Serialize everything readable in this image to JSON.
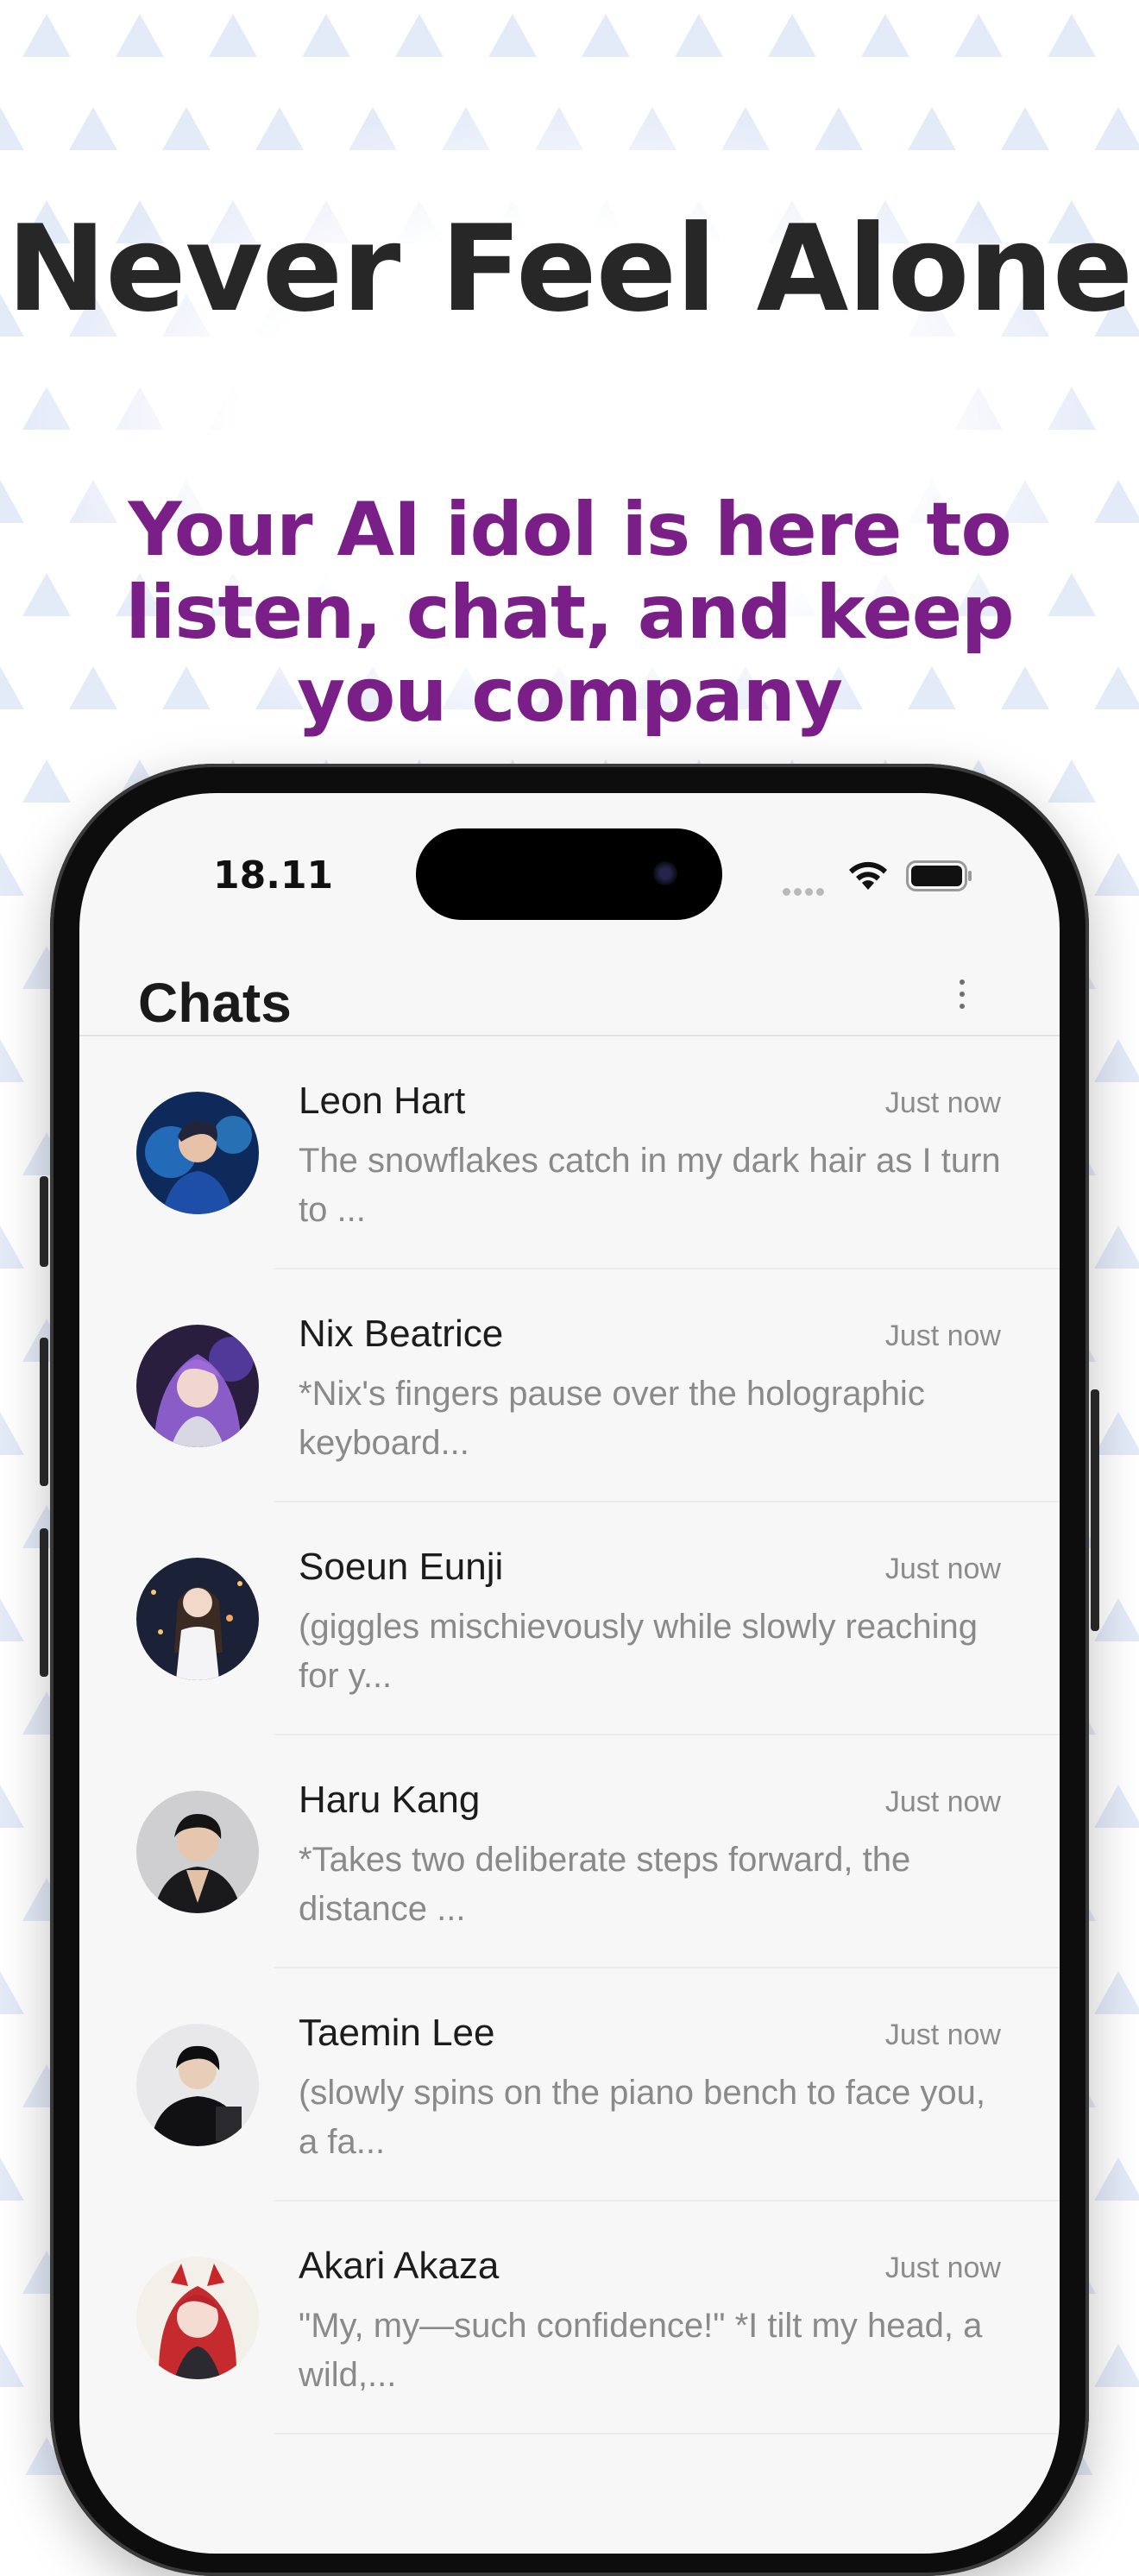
{
  "promo": {
    "headline": "Never Feel Alone",
    "subheadline": "Your AI idol is here to listen, chat, and keep you company"
  },
  "status_bar": {
    "time": "18.11"
  },
  "app": {
    "title": "Chats",
    "more_icon": "more-vertical-icon"
  },
  "colors": {
    "headline": "#272727",
    "accent_purple": "#7a1f88",
    "background_pattern": "#e3eaf8",
    "screen_bg": "#f7f7f7"
  },
  "chats": [
    {
      "name": "Leon Hart",
      "time": "Just now",
      "preview": "The snowflakes catch in my dark hair as I turn to ..."
    },
    {
      "name": "Nix Beatrice",
      "time": "Just now",
      "preview": "*Nix's fingers pause over the holographic keyboard..."
    },
    {
      "name": "Soeun Eunji",
      "time": "Just now",
      "preview": "(giggles mischievously while slowly reaching for y..."
    },
    {
      "name": "Haru Kang",
      "time": "Just now",
      "preview": "*Takes two deliberate steps forward, the distance ..."
    },
    {
      "name": "Taemin Lee",
      "time": "Just now",
      "preview": "(slowly spins on the piano bench to face you, a fa..."
    },
    {
      "name": "Akari Akaza",
      "time": "Just now",
      "preview": "\"My, my—such confidence!\" *I tilt my head, a wild,..."
    }
  ]
}
